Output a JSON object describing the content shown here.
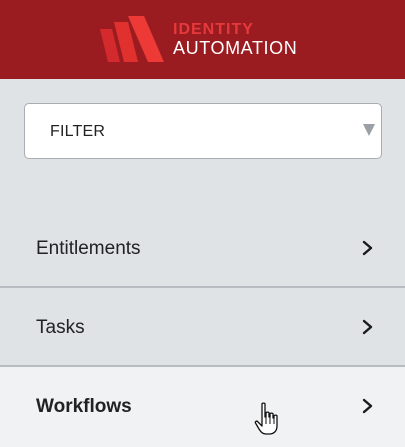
{
  "header": {
    "logo_line1": "IDENTITY",
    "logo_line2": "AUTOMATION",
    "logo_icon": "identity-automation-mark",
    "background_color": "#9b1c20",
    "accent_color": "#e6393c"
  },
  "filter": {
    "label": "FILTER",
    "icon": "dropdown-triangle-icon"
  },
  "menu": {
    "items": [
      {
        "label": "Entitlements",
        "icon": "chevron-right-icon"
      },
      {
        "label": "Tasks",
        "icon": "chevron-right-icon"
      },
      {
        "label": "Workflows",
        "icon": "chevron-right-icon",
        "active": true
      }
    ]
  },
  "cursor": {
    "icon": "hand-pointer-cursor-icon"
  }
}
